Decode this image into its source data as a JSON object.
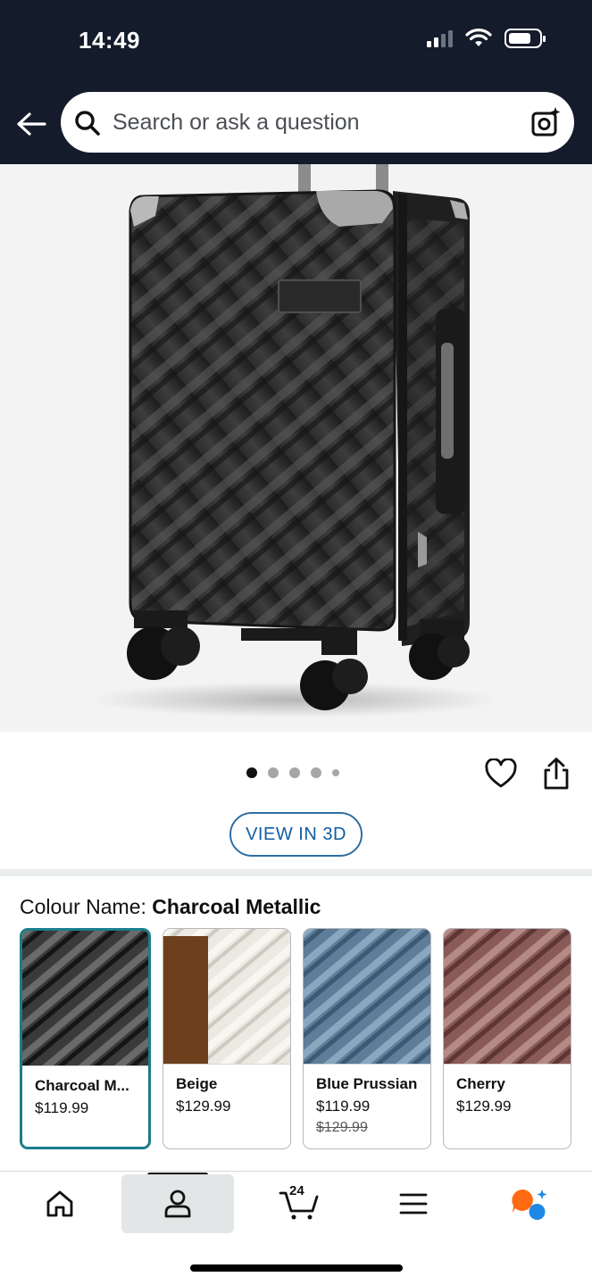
{
  "status_bar": {
    "time": "14:49"
  },
  "search": {
    "placeholder": "Search or ask a question"
  },
  "gallery": {
    "image_count": 5,
    "active_index": 0,
    "view_3d_label": "VIEW IN 3D"
  },
  "colour": {
    "label": "Colour Name:",
    "selected": "Charcoal Metallic",
    "options": [
      {
        "name": "Charcoal M...",
        "price": "$119.99",
        "selected": true
      },
      {
        "name": "Beige",
        "price": "$129.99"
      },
      {
        "name": "Blue Prussian",
        "price": "$119.99",
        "old_price": "$129.99"
      },
      {
        "name": "Cherry",
        "price": "$129.99"
      }
    ]
  },
  "nav": {
    "items": [
      "home-icon",
      "account-icon",
      "cart-icon",
      "menu-icon",
      "rufus-icon"
    ],
    "active": "account-icon",
    "cart_count": "24"
  },
  "colors": {
    "header_bg": "#141b2a",
    "accent": "#1a7d8c",
    "link": "#0f5ea3",
    "rufus_orange": "#ff6a13",
    "rufus_blue": "#1e88e5"
  }
}
